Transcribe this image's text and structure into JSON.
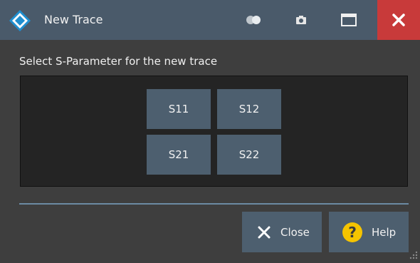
{
  "window": {
    "title": "New Trace"
  },
  "titlebar": {
    "buttons": [
      "toggle-icon",
      "camera-icon",
      "maximize-icon",
      "close-icon"
    ],
    "close_color": "#c83a3a"
  },
  "content": {
    "instruction": "Select S-Parameter for the new trace",
    "sparams": [
      "S11",
      "S12",
      "S21",
      "S22"
    ]
  },
  "footer": {
    "close_label": "Close",
    "help_label": "Help"
  },
  "colors": {
    "accent": "#4d5f6f",
    "help_icon": "#f5c400"
  }
}
